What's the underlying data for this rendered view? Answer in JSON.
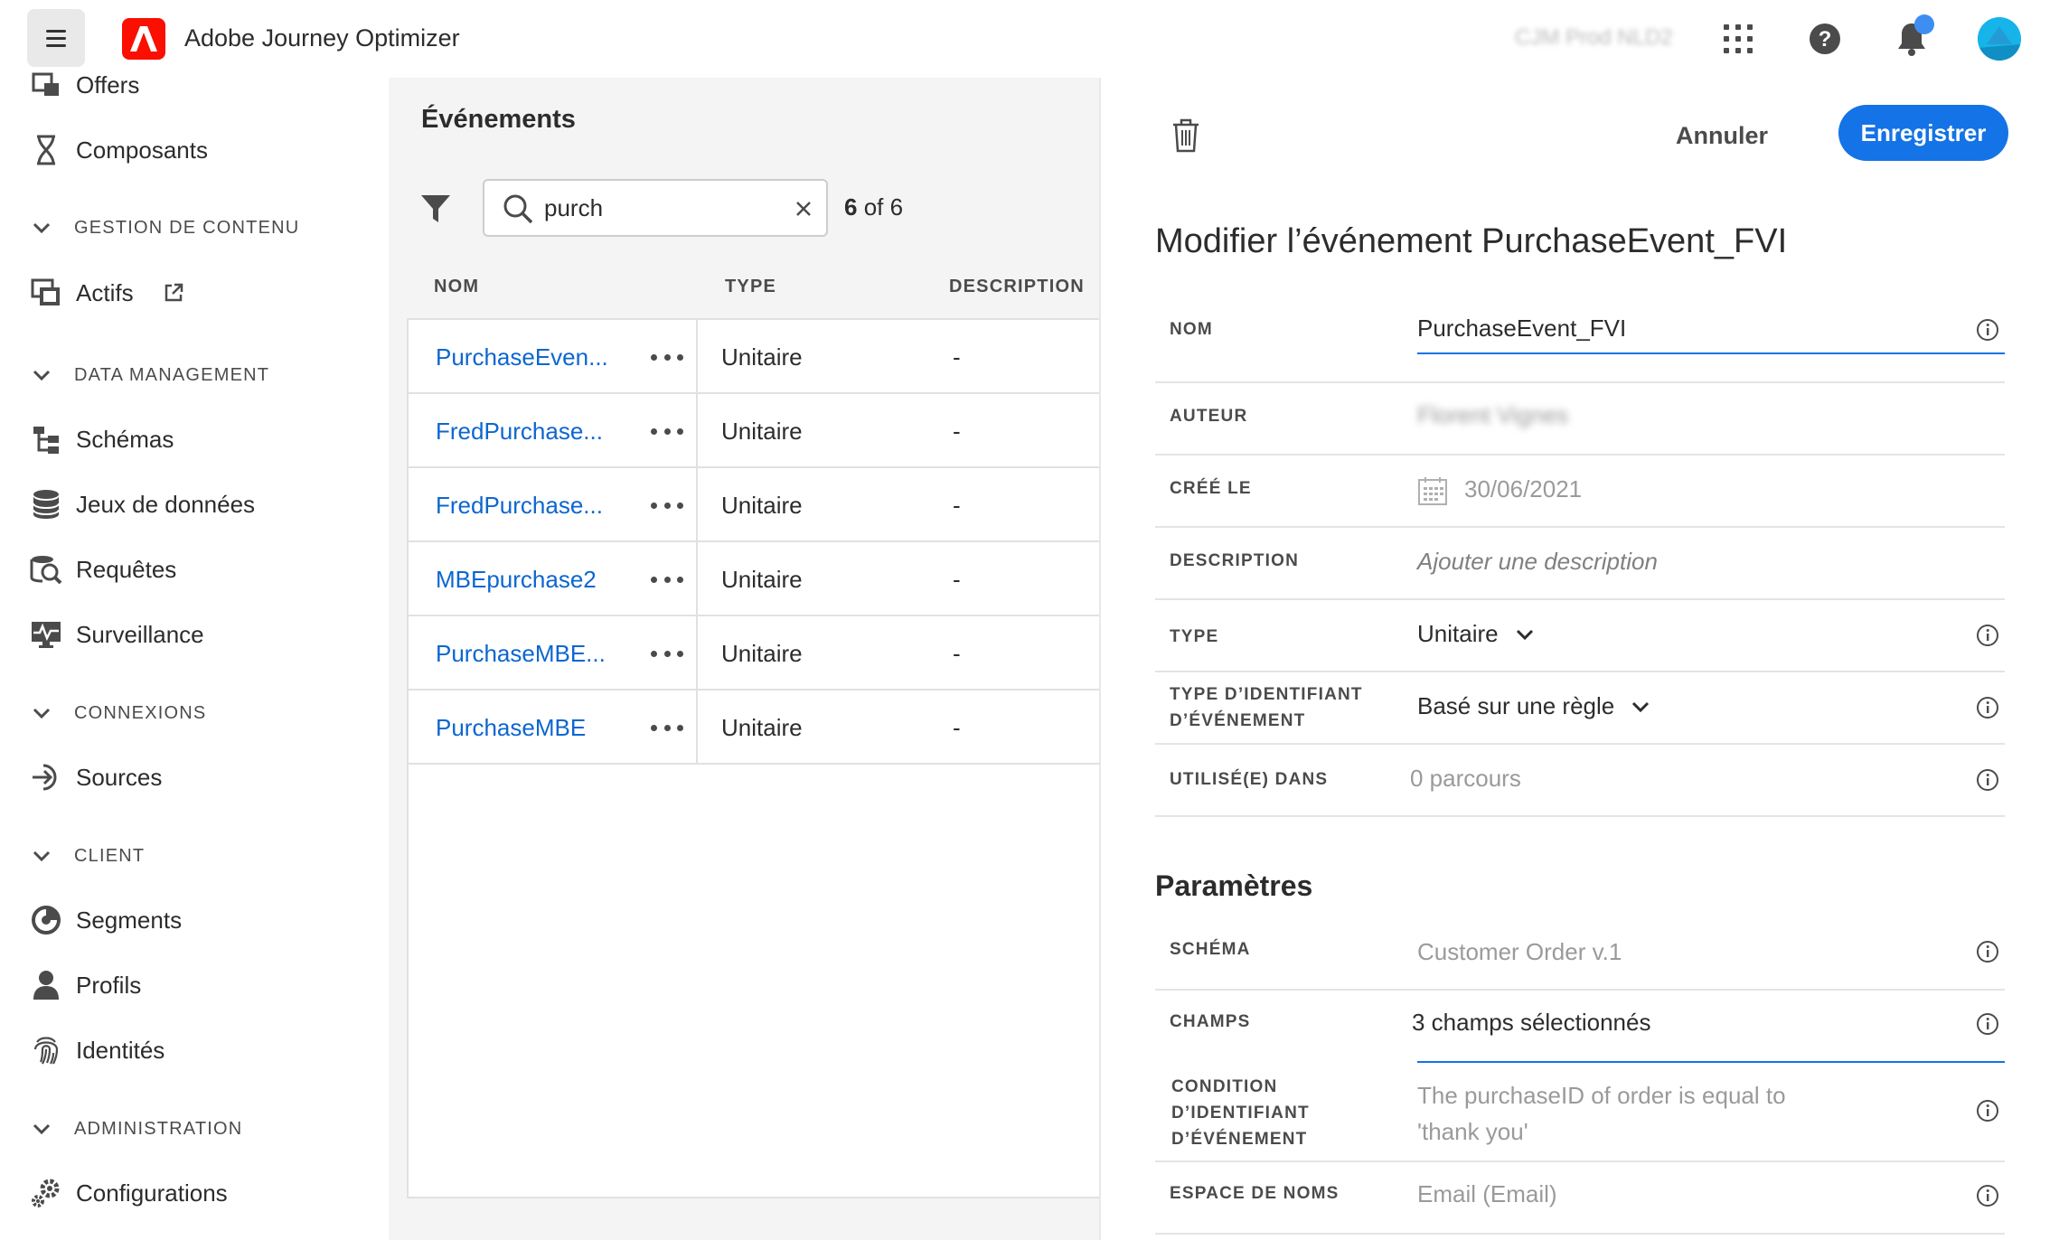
{
  "app": {
    "title": "Adobe Journey Optimizer",
    "org_label": "CJM Prod NLD2"
  },
  "sidebar": {
    "items_top": [
      {
        "label": "Offers",
        "icon": "offers-icon"
      },
      {
        "label": "Composants",
        "icon": "components-icon"
      }
    ],
    "sections": [
      {
        "title": "GESTION DE CONTENU",
        "items": [
          {
            "label": "Actifs",
            "icon": "assets-icon",
            "external": true
          }
        ]
      },
      {
        "title": "DATA MANAGEMENT",
        "items": [
          {
            "label": "Schémas",
            "icon": "schema-icon"
          },
          {
            "label": "Jeux de données",
            "icon": "datasets-icon"
          },
          {
            "label": "Requêtes",
            "icon": "queries-icon"
          },
          {
            "label": "Surveillance",
            "icon": "monitoring-icon"
          }
        ]
      },
      {
        "title": "CONNEXIONS",
        "items": [
          {
            "label": "Sources",
            "icon": "sources-icon"
          }
        ]
      },
      {
        "title": "CLIENT",
        "items": [
          {
            "label": "Segments",
            "icon": "segments-icon"
          },
          {
            "label": "Profils",
            "icon": "profiles-icon"
          },
          {
            "label": "Identités",
            "icon": "identities-icon"
          }
        ]
      },
      {
        "title": "ADMINISTRATION",
        "items": [
          {
            "label": "Configurations",
            "icon": "configurations-icon"
          }
        ]
      }
    ]
  },
  "events": {
    "title": "Événements",
    "search_value": "purch",
    "count_current": "6",
    "count_of": "of 6",
    "columns": [
      "NOM",
      "TYPE",
      "DESCRIPTION"
    ],
    "rows": [
      {
        "name": "PurchaseEven...",
        "type": "Unitaire",
        "description": "-"
      },
      {
        "name": "FredPurchase...",
        "type": "Unitaire",
        "description": "-"
      },
      {
        "name": "FredPurchase...",
        "type": "Unitaire",
        "description": "-"
      },
      {
        "name": "MBEpurchase2",
        "type": "Unitaire",
        "description": "-"
      },
      {
        "name": "PurchaseMBE...",
        "type": "Unitaire",
        "description": "-"
      },
      {
        "name": "PurchaseMBE",
        "type": "Unitaire",
        "description": "-"
      }
    ]
  },
  "detail": {
    "cancel_label": "Annuler",
    "save_label": "Enregistrer",
    "title": "Modifier l’événement PurchaseEvent_FVI",
    "fields": {
      "name_label": "NOM",
      "name_value": "PurchaseEvent_FVI",
      "author_label": "AUTEUR",
      "author_value": "Florent Vignes",
      "created_label": "CRÉÉ LE",
      "created_value": "30/06/2021",
      "description_label": "DESCRIPTION",
      "description_placeholder": "Ajouter une description",
      "type_label": "TYPE",
      "type_value": "Unitaire",
      "id_type_label_1": "TYPE D’IDENTIFIANT",
      "id_type_label_2": "D’ÉVÉNEMENT",
      "id_type_value": "Basé sur une règle",
      "used_in_label": "UTILISÉ(E) DANS",
      "used_in_value": "0 parcours"
    },
    "params_title": "Paramètres",
    "params": {
      "schema_label": "SCHÉMA",
      "schema_value": "Customer Order v.1",
      "fields_label": "CHAMPS",
      "fields_value": "3 champs sélectionnés",
      "condition_label_1": "CONDITION",
      "condition_label_2": "D’IDENTIFIANT",
      "condition_label_3": "D’ÉVÉNEMENT",
      "condition_value_1": "The purchaseID of order is equal to",
      "condition_value_2": "'thank you'",
      "namespace_label": "ESPACE DE NOMS",
      "namespace_value": "Email (Email)"
    }
  },
  "colors": {
    "accent": "#1473e6",
    "link": "#0d66d0",
    "adobe_red": "#fa0f00"
  }
}
